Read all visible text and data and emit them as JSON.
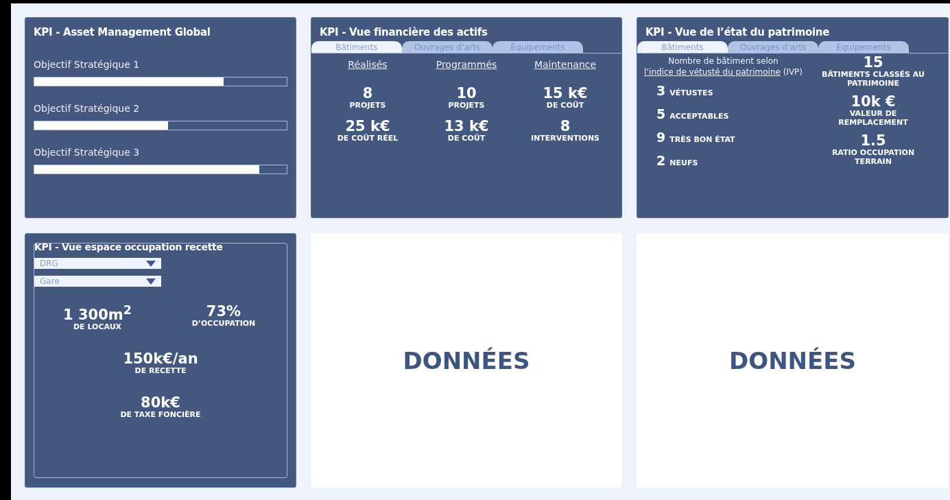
{
  "cards": [
    {
      "kind": "objectives",
      "title": "KPI - Asset Management Global",
      "objectives": [
        {
          "label": "Objectif Stratégique 1",
          "level": 0.75
        },
        {
          "label": "Objectif Stratégique 2",
          "level": 0.53
        },
        {
          "label": "Objectif Stratégique 3",
          "level": 0.89
        }
      ]
    },
    {
      "kind": "financial",
      "title": "KPI - Vue financière des actifs",
      "tabs": [
        {
          "label": "Bâtiments",
          "selected": true
        },
        {
          "label": "Ouvrages d’arts",
          "selected": false
        },
        {
          "label": "Équipements",
          "selected": false
        }
      ],
      "columns": [
        {
          "heading": "Réalisés",
          "stats": [
            {
              "value": "8",
              "label": "PROJETS"
            },
            {
              "value": "25 k€",
              "label": "DE COÛT RÉEL"
            }
          ]
        },
        {
          "heading": "Programmés",
          "stats": [
            {
              "value": "10",
              "label": "PROJETS"
            },
            {
              "value": "13 k€",
              "label": "DE COÛT"
            }
          ]
        },
        {
          "heading": "Maintenance",
          "stats": [
            {
              "value": "15 k€",
              "label": "DE COÛT"
            },
            {
              "value": "8",
              "label": "INTERVENTIONS"
            }
          ]
        }
      ]
    },
    {
      "kind": "heritage",
      "title": "KPI - Vue de l’état du patrimoine",
      "tabs": [
        {
          "label": "Bâtiments",
          "selected": true
        },
        {
          "label": "Ouvrages d’arts",
          "selected": false
        },
        {
          "label": "Équipements",
          "selected": false
        }
      ],
      "intro": {
        "text": "Nombre de bâtiment selon",
        "link": "l’indice de vétusté du patrimoine",
        "suffix": "(IVP)"
      },
      "counts": [
        {
          "value": "3",
          "label": "VÉTUSTES"
        },
        {
          "value": "5",
          "label": "ACCEPTABLES"
        },
        {
          "value": "9",
          "label": "TRÈS BON ÉTAT"
        },
        {
          "value": "2",
          "label": "NEUFS"
        }
      ],
      "stats": [
        {
          "value": "15",
          "label": "BÂTIMENTS CLASSÉS AU PATRIMOINE"
        },
        {
          "value": "10k €",
          "label": "VALEUR DE REMPLACEMENT"
        },
        {
          "value": "1.5",
          "label": "RATIO OCCUPATION TERRAIN"
        }
      ]
    },
    {
      "kind": "occupation",
      "title": "KPI - Vue espace occupation recette",
      "dropdowns": [
        {
          "value": "DRG"
        },
        {
          "value": "Gare"
        }
      ],
      "stats": [
        {
          "value": "1 300m$^{2}$",
          "label": "DE LOCAUX"
        },
        {
          "value": "73%",
          "label": "D’OCCUPATION"
        },
        {
          "value": "150k€/an",
          "label": "DE RECETTE"
        },
        {
          "value": "80k€",
          "label": "DE TAXE FONCIÈRE"
        }
      ]
    },
    {
      "kind": "placeholder",
      "text": "DONNÉES"
    },
    {
      "kind": "placeholder",
      "text": "DONNÉES"
    }
  ]
}
